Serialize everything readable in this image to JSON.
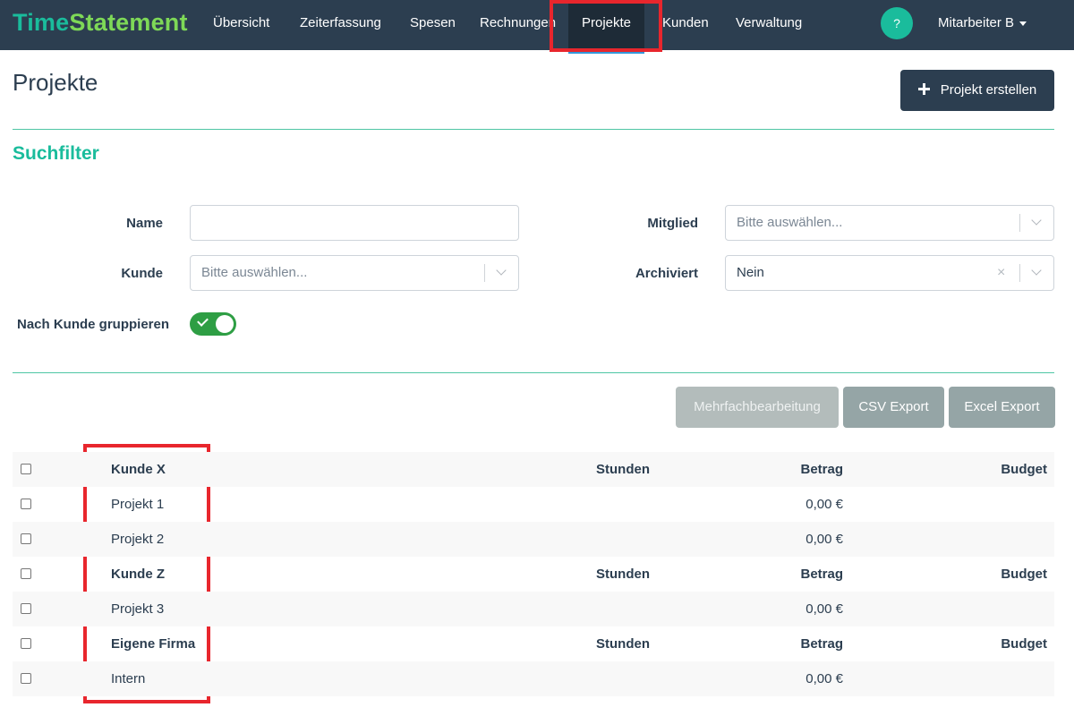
{
  "nav": {
    "brand_part1": "Time",
    "brand_part2": "Statement",
    "items": [
      {
        "label": "Übersicht"
      },
      {
        "label": "Zeiterfassung"
      },
      {
        "label": "Spesen"
      },
      {
        "label": "Rechnungen"
      },
      {
        "label": "Projekte",
        "active": true
      },
      {
        "label": "Kunden"
      },
      {
        "label": "Verwaltung"
      }
    ],
    "help_label": "?",
    "user_label": "Mitarbeiter B"
  },
  "page": {
    "title": "Projekte",
    "create_button_label": "Projekt erstellen"
  },
  "filter": {
    "section_title": "Suchfilter",
    "name_label": "Name",
    "name_value": "",
    "customer_label": "Kunde",
    "customer_placeholder": "Bitte auswählen...",
    "member_label": "Mitglied",
    "member_placeholder": "Bitte auswählen...",
    "archived_label": "Archiviert",
    "archived_value": "Nein",
    "clear_symbol": "×",
    "group_label": "Nach Kunde gruppieren",
    "group_enabled": true
  },
  "actions": {
    "bulk_edit_label": "Mehrfachbearbeitung",
    "csv_export_label": "CSV Export",
    "excel_export_label": "Excel Export"
  },
  "table": {
    "rows": [
      {
        "type": "group",
        "name": "Kunde X",
        "hours": "Stunden",
        "amount": "Betrag",
        "budget": "Budget"
      },
      {
        "type": "project",
        "name": "Projekt 1",
        "hours": "",
        "amount": "0,00 €",
        "budget": ""
      },
      {
        "type": "project",
        "name": "Projekt 2",
        "hours": "",
        "amount": "0,00 €",
        "budget": ""
      },
      {
        "type": "group",
        "name": "Kunde Z",
        "hours": "Stunden",
        "amount": "Betrag",
        "budget": "Budget"
      },
      {
        "type": "project",
        "name": "Projekt 3",
        "hours": "",
        "amount": "0,00 €",
        "budget": ""
      },
      {
        "type": "group",
        "name": "Eigene Firma",
        "hours": "Stunden",
        "amount": "Betrag",
        "budget": "Budget"
      },
      {
        "type": "project",
        "name": "Intern",
        "hours": "",
        "amount": "0,00 €",
        "budget": ""
      }
    ]
  },
  "colors": {
    "navbar": "#2c3e50",
    "accent": "#1abc9c",
    "brand_green": "#7ed957",
    "highlight": "#e8262d",
    "toggle_on": "#2e9e44"
  },
  "icons": {
    "create": "plus-icon",
    "user_menu": "caret-down-icon",
    "select_open": "chevron-down-icon",
    "select_clear": "clear-icon",
    "toggle": "check-icon"
  }
}
